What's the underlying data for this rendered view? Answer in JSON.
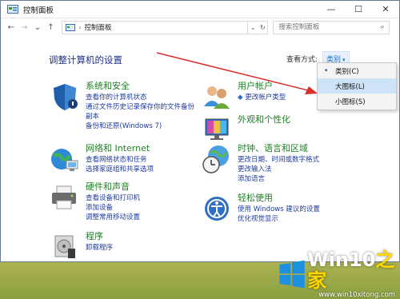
{
  "window": {
    "title": "控制面板",
    "controls": {
      "minimize": "—",
      "maximize": "☐",
      "close": "✕"
    }
  },
  "nav": {
    "back": "←",
    "forward": "→",
    "recent": "⌄",
    "up": "↑"
  },
  "address": {
    "separator": "›",
    "path": "控制面板",
    "dropdown": "⌄",
    "refresh": "↻"
  },
  "search": {
    "placeholder": "搜索控制面板",
    "icon": "search-icon"
  },
  "main": {
    "heading": "调整计算机的设置",
    "view_by_label": "查看方式:",
    "view_by_value": "类别",
    "view_by_caret": "▾"
  },
  "categories": [
    {
      "icon": "shield-icon",
      "title": "系统和安全",
      "links": [
        "查看你的计算机状态",
        "通过文件历史记录保存你的文件备份",
        "副本",
        "备份和还原(Windows 7)"
      ]
    },
    {
      "icon": "network-icon",
      "title": "网络和 Internet",
      "links": [
        "查看网络状态和任务",
        "选择家庭组和共享选项"
      ]
    },
    {
      "icon": "printer-icon",
      "title": "硬件和声音",
      "links": [
        "查看设备和打印机",
        "添加设备",
        "调整常用移动设置"
      ]
    },
    {
      "icon": "programs-icon",
      "title": "程序",
      "links": [
        "卸载程序"
      ]
    },
    {
      "icon": "users-icon",
      "title": "用户帐户",
      "links": [
        "更改帐户类型"
      ]
    },
    {
      "icon": "monitor-icon",
      "title": "外观和个性化",
      "links": []
    },
    {
      "icon": "clock-globe-icon",
      "title": "时钟、语言和区域",
      "links": [
        "更改日期、时间或数字格式",
        "更改输入法",
        "添加语言"
      ]
    },
    {
      "icon": "ease-of-access-icon",
      "title": "轻松使用",
      "links": [
        "使用 Windows 建议的设置",
        "优化视觉显示"
      ]
    }
  ],
  "dropdown": {
    "items": [
      {
        "label": "类别(C)",
        "selected": true
      },
      {
        "label": "大图标(L)",
        "selected": false
      },
      {
        "label": "小图标(S)",
        "selected": false
      }
    ],
    "bullet": "•"
  },
  "watermark": {
    "brand": "Win10",
    "brand_zh": "之家",
    "url": "www.win10xitong.com"
  },
  "colors": {
    "link": "#1e3a9e",
    "category_title": "#1f8024",
    "heading": "#1e3287",
    "arrow": "#d9302c",
    "win_blue": "#1e90e0"
  }
}
